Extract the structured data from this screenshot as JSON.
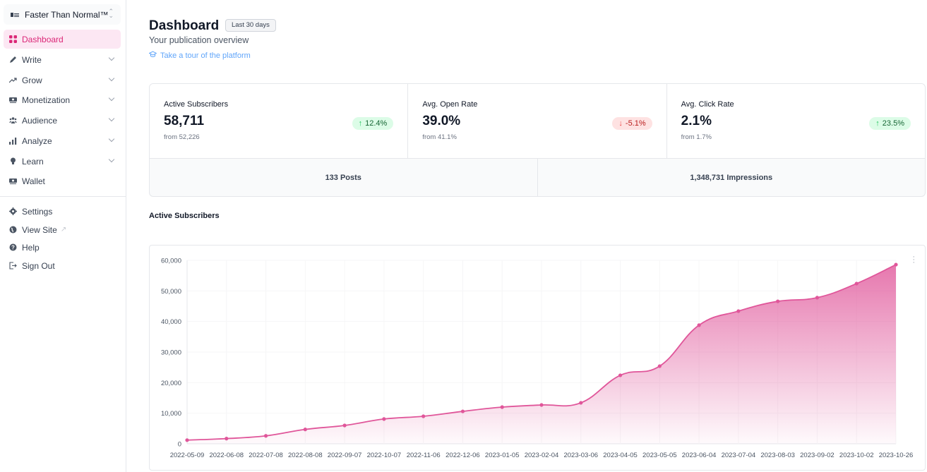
{
  "sidebar": {
    "publication": {
      "name": "Faster Than Normal™",
      "icon": "publication-logo-icon",
      "selector_icon": "chevron-up-down-icon"
    },
    "items": [
      {
        "label": "Dashboard",
        "icon": "grid-icon",
        "active": true,
        "expandable": false
      },
      {
        "label": "Write",
        "icon": "pencil-icon",
        "active": false,
        "expandable": true
      },
      {
        "label": "Grow",
        "icon": "trending-up-icon",
        "active": false,
        "expandable": true
      },
      {
        "label": "Monetization",
        "icon": "money-icon",
        "active": false,
        "expandable": true
      },
      {
        "label": "Audience",
        "icon": "users-icon",
        "active": false,
        "expandable": true
      },
      {
        "label": "Analyze",
        "icon": "bar-chart-icon",
        "active": false,
        "expandable": true
      },
      {
        "label": "Learn",
        "icon": "lightbulb-icon",
        "active": false,
        "expandable": true
      },
      {
        "label": "Wallet",
        "icon": "wallet-icon",
        "active": false,
        "expandable": false
      }
    ],
    "footer_items": [
      {
        "label": "Settings",
        "icon": "gear-icon"
      },
      {
        "label": "View Site",
        "icon": "globe-icon",
        "external": true
      },
      {
        "label": "Help",
        "icon": "question-icon"
      },
      {
        "label": "Sign Out",
        "icon": "sign-out-icon"
      }
    ]
  },
  "header": {
    "title": "Dashboard",
    "range_badge": "Last 30 days",
    "subtitle": "Your publication overview",
    "tour_link": "Take a tour of the platform"
  },
  "stats": [
    {
      "label": "Active Subscribers",
      "value": "58,711",
      "from": "from 52,226",
      "change": "12.4%",
      "direction": "up"
    },
    {
      "label": "Avg. Open Rate",
      "value": "39.0%",
      "from": "from 41.1%",
      "change": "-5.1%",
      "direction": "down"
    },
    {
      "label": "Avg. Click Rate",
      "value": "2.1%",
      "from": "from 1.7%",
      "change": "23.5%",
      "direction": "up"
    }
  ],
  "totals": [
    {
      "label": "133 Posts"
    },
    {
      "label": "1,348,731 Impressions"
    }
  ],
  "colors": {
    "accent": "#db2777",
    "line": "#e0569a",
    "up_bg": "#dcfce7",
    "down_bg": "#fee2e2"
  },
  "chart_section_title": "Active Subscribers",
  "chart_data": {
    "type": "area",
    "title": "Active Subscribers",
    "xlabel": "",
    "ylabel": "",
    "ylim": [
      0,
      60000
    ],
    "yticks": [
      "0",
      "10,000",
      "20,000",
      "30,000",
      "40,000",
      "50,000",
      "60,000"
    ],
    "grid": true,
    "legend": "none",
    "categories": [
      "2022-05-09",
      "2022-06-08",
      "2022-07-08",
      "2022-08-08",
      "2022-09-07",
      "2022-10-07",
      "2022-11-06",
      "2022-12-06",
      "2023-01-05",
      "2023-02-04",
      "2023-03-06",
      "2023-04-05",
      "2023-05-05",
      "2023-06-04",
      "2023-07-04",
      "2023-08-03",
      "2023-09-02",
      "2023-10-02",
      "2023-10-26"
    ],
    "series": [
      {
        "name": "Active Subscribers",
        "values": [
          1200,
          1700,
          2600,
          4700,
          6000,
          8100,
          9000,
          10600,
          12000,
          12700,
          13400,
          22400,
          25400,
          38800,
          43400,
          46600,
          47800,
          52400,
          58600
        ]
      }
    ]
  }
}
